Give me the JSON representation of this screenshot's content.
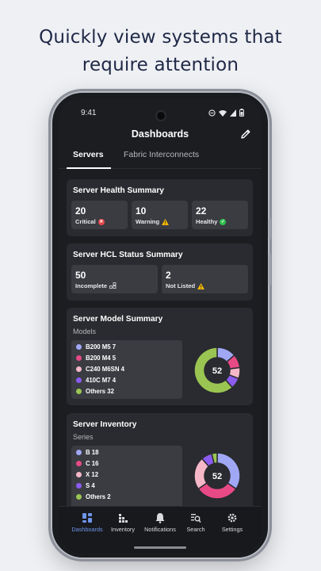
{
  "headline": {
    "line1": "Quickly view systems that",
    "line2": "require attention"
  },
  "status_bar": {
    "time": "9:41"
  },
  "app_bar": {
    "title": "Dashboards"
  },
  "tabs": [
    {
      "label": "Servers",
      "active": true
    },
    {
      "label": "Fabric Interconnects",
      "active": false
    }
  ],
  "health_summary": {
    "title": "Server Health Summary",
    "items": [
      {
        "value": "20",
        "label": "Critical",
        "icon": "error-icon",
        "color": "#e5484d"
      },
      {
        "value": "10",
        "label": "Warning",
        "icon": "warning-icon",
        "color": "#f5b700"
      },
      {
        "value": "22",
        "label": "Healthy",
        "icon": "check-icon",
        "color": "#30c04f"
      }
    ]
  },
  "hcl_summary": {
    "title": "Server HCL Status Summary",
    "items": [
      {
        "value": "50",
        "label": "Incomplete",
        "icon": "incomplete-icon"
      },
      {
        "value": "2",
        "label": "Not Listed",
        "icon": "warning-icon"
      }
    ]
  },
  "model_summary": {
    "title": "Server Model Summary",
    "subtitle": "Models",
    "center": "52",
    "items": [
      {
        "label": "B200 M5 7",
        "value": 7,
        "color": "#a0a8f6"
      },
      {
        "label": "B200 M4 5",
        "value": 5,
        "color": "#e84a86"
      },
      {
        "label": "C240 M6SN 4",
        "value": 4,
        "color": "#f6b8c8"
      },
      {
        "label": "410C M7 4",
        "value": 4,
        "color": "#8c5cf0"
      },
      {
        "label": "Others 32",
        "value": 32,
        "color": "#9ac552"
      }
    ]
  },
  "inventory": {
    "title": "Server Inventory",
    "subtitle": "Series",
    "center": "52",
    "items": [
      {
        "label": "B 18",
        "value": 18,
        "color": "#a0a8f6"
      },
      {
        "label": "C 16",
        "value": 16,
        "color": "#e84a86"
      },
      {
        "label": "X 12",
        "value": 12,
        "color": "#f6b8c8"
      },
      {
        "label": "S 4",
        "value": 4,
        "color": "#8c5cf0"
      },
      {
        "label": "Others 2",
        "value": 2,
        "color": "#9ac552"
      }
    ]
  },
  "bottom_nav": [
    {
      "label": "Dashboards",
      "icon": "dashboard-icon",
      "active": true
    },
    {
      "label": "Inventory",
      "icon": "inventory-icon",
      "active": false
    },
    {
      "label": "Notifications",
      "icon": "bell-icon",
      "active": false
    },
    {
      "label": "Search",
      "icon": "search-icon",
      "active": false
    },
    {
      "label": "Settings",
      "icon": "gear-icon",
      "active": false
    }
  ],
  "colors": {
    "accent": "#6f95e9",
    "card_bg": "#2a2b30",
    "tile_bg": "#3a3c42"
  }
}
